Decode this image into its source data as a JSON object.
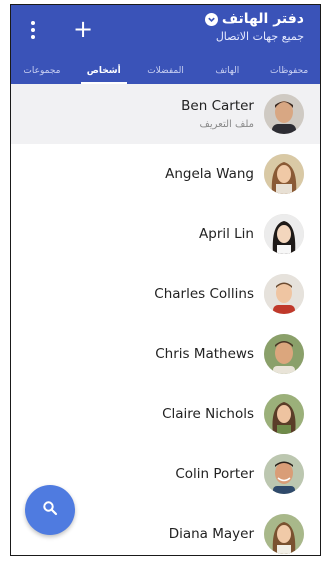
{
  "header": {
    "title": "دفتر الهاتف",
    "subtitle": "جميع جهات الاتصال",
    "menu_icon": "more-vertical-icon",
    "add_icon": "plus-icon",
    "background": "#3a53b8"
  },
  "tabs": [
    {
      "label": "محفوظات",
      "active": false
    },
    {
      "label": "الهاتف",
      "active": false
    },
    {
      "label": "المفضلات",
      "active": false
    },
    {
      "label": "أشخاص",
      "active": true
    },
    {
      "label": "مجموعات",
      "active": false
    }
  ],
  "contacts": [
    {
      "name": "Ben Carter",
      "subtitle": "ملف التعريف"
    },
    {
      "name": "Angela Wang"
    },
    {
      "name": "April Lin"
    },
    {
      "name": "Charles Collins"
    },
    {
      "name": "Chris Mathews"
    },
    {
      "name": "Claire Nichols"
    },
    {
      "name": "Colin Porter"
    },
    {
      "name": "Diana Mayer"
    }
  ],
  "fab": {
    "icon": "search-icon",
    "color": "#4f7be0"
  }
}
